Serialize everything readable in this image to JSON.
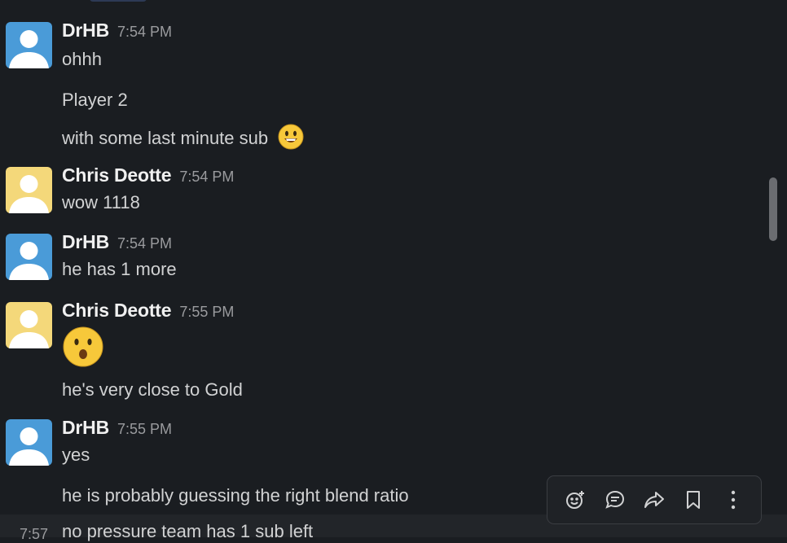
{
  "messages": [
    {
      "author": "DrHB",
      "time": "7:54 PM",
      "lines": [
        "ohhh",
        "Player 2",
        "with some last minute sub"
      ]
    },
    {
      "author": "Chris Deotte",
      "time": "7:54 PM",
      "lines": [
        "wow 1118"
      ]
    },
    {
      "author": "DrHB",
      "time": "7:54 PM",
      "lines": [
        "he has 1 more"
      ]
    },
    {
      "author": "Chris Deotte",
      "time": "7:55 PM",
      "lines": [
        "he's very close to Gold"
      ]
    },
    {
      "author": "DrHB",
      "time": "7:55 PM",
      "lines": [
        "yes",
        "he is probably guessing the right blend ratio"
      ]
    }
  ],
  "footer": {
    "time": "7:57",
    "text": "no pressure team has 1 sub left"
  },
  "toolbar": {
    "icons": [
      "add-reaction-icon",
      "reply-thread-icon",
      "share-icon",
      "bookmark-icon",
      "more-actions-icon"
    ]
  },
  "colors": {
    "background": "#1a1d21",
    "avatar_blue": "#4a9bd8",
    "avatar_yellow": "#f4d87a"
  }
}
